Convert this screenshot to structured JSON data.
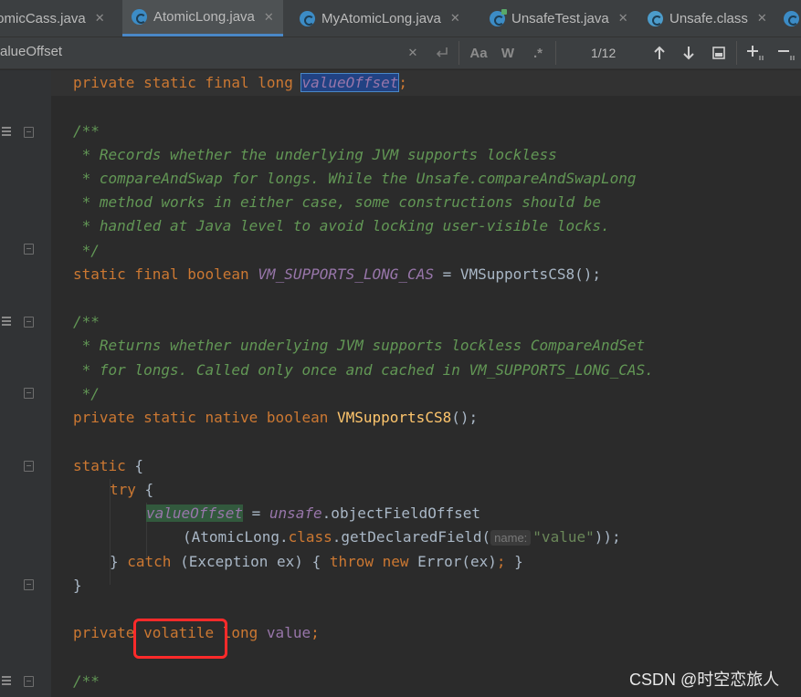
{
  "tabs": [
    {
      "label": "AtomicCass.java",
      "visible_text": "tomicCass.java",
      "icon": "java-class-icon"
    },
    {
      "label": "AtomicLong.java",
      "icon": "java-class-icon",
      "active": true
    },
    {
      "label": "MyAtomicLong.java",
      "icon": "java-class-icon"
    },
    {
      "label": "UnsafeTest.java",
      "icon": "java-runnable-class-icon"
    },
    {
      "label": "Unsafe.class",
      "icon": "class-file-icon"
    }
  ],
  "close_glyph": "✕",
  "search": {
    "query": "alueOffset",
    "match_case_label": "Aa",
    "words_label": "W",
    "regex_label": ".*",
    "match_count": "1/12",
    "clear_icon": "close-icon",
    "replace_icon": "return-icon",
    "prev_icon": "arrow-up-icon",
    "next_icon": "arrow-down-icon",
    "select_all_icon": "select-all-occurrences-icon",
    "add_selection_icon": "add-selection-icon",
    "remove_selection_icon": "remove-selection-icon"
  },
  "code": {
    "l1": {
      "a": "private static final long ",
      "b": "valueOffset",
      "c": ";"
    },
    "l3": "/**",
    "l4": " * Records whether the underlying JVM supports lockless",
    "l5": " * compareAndSwap for longs. While the Unsafe.compareAndSwapLong",
    "l6": " * method works in either case, some constructions should be",
    "l7": " * handled at Java level to avoid locking user-visible locks.",
    "l8": " */",
    "l9": {
      "a": "static final boolean ",
      "b": "VM_SUPPORTS_LONG_CAS",
      "c": " = ",
      "d": "VMSupportsCS8",
      "e": "();"
    },
    "l11": "/**",
    "l12": " * Returns whether underlying JVM supports lockless CompareAndSet",
    "l13": " * for longs. Called only once and cached in VM_SUPPORTS_LONG_CAS.",
    "l14": " */",
    "l15": {
      "a": "private static native boolean ",
      "b": "VMSupportsCS8",
      "c": "();"
    },
    "l17": {
      "a": "static",
      "b": " {"
    },
    "l18": {
      "a": "try",
      "b": " {"
    },
    "l19": {
      "a": "valueOffset",
      "b": " = ",
      "c": "unsafe",
      "d": ".objectFieldOffset"
    },
    "l20": {
      "a": "(AtomicLong.",
      "b": "class",
      "c": ".getDeclaredField(",
      "hint": "name:",
      "d": "\"value\"",
      "e": "));"
    },
    "l21": {
      "a": "} ",
      "b": "catch",
      "c": " (Exception ex) { ",
      "d": "throw new",
      "e": " Error(ex)",
      "f": ";",
      "g": " }"
    },
    "l22": "}",
    "l24": {
      "a": "private ",
      "b": "volatile",
      "c": " long ",
      "d": "value",
      "e": ";"
    },
    "l26": "/**"
  },
  "watermark": "CSDN @时空恋旅人",
  "colors": {
    "keyword": "#cc7832",
    "comment": "#629755",
    "field": "#9876aa",
    "method": "#ffc66d",
    "string": "#6a8759",
    "annotation_box": "#ff2a2a"
  }
}
